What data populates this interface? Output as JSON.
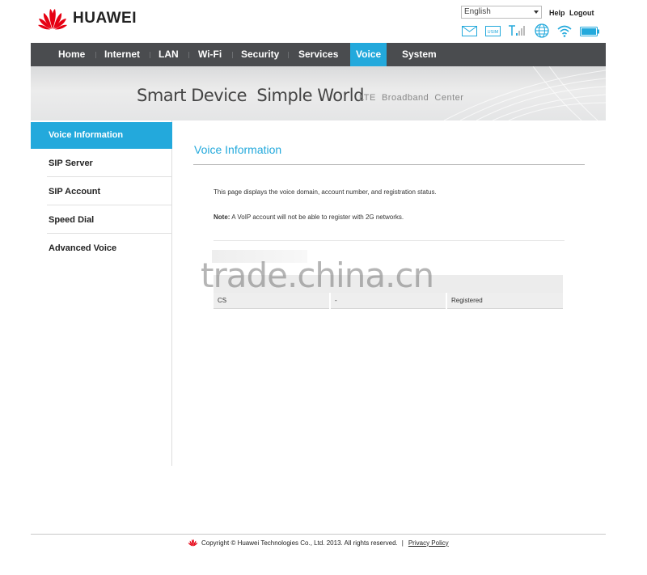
{
  "brand": {
    "name": "HUAWEI"
  },
  "header": {
    "language": "English",
    "help": "Help",
    "logout": "Logout",
    "status_icons": [
      "mail-icon",
      "usim-icon",
      "signal-icon",
      "globe-icon",
      "wifi-icon",
      "battery-icon"
    ],
    "usim_label": "USIM"
  },
  "nav": {
    "items": [
      "Home",
      "Internet",
      "LAN",
      "Wi-Fi",
      "Security",
      "Services",
      "Voice",
      "System"
    ],
    "active": "Voice"
  },
  "banner": {
    "main": "Smart Device  Simple World",
    "sub": "LTE  Broadband  Center"
  },
  "sidebar": {
    "items": [
      "Voice Information",
      "SIP Server",
      "SIP Account",
      "Speed Dial",
      "Advanced Voice"
    ],
    "active": "Voice Information"
  },
  "content": {
    "title": "Voice Information",
    "description": "This page displays the voice domain, account number, and registration status.",
    "note_label": "Note:",
    "note_text": " A VoIP account will not be able to register with 2G networks.",
    "table": {
      "rows": [
        {
          "domain": "CS",
          "account": "-",
          "status": "Registered"
        }
      ]
    }
  },
  "watermark": "trade.china.cn",
  "footer": {
    "copyright": "Copyright © Huawei Technologies Co., Ltd. 2013. All rights reserved.",
    "separator": "|",
    "privacy": "Privacy Policy"
  },
  "colors": {
    "accent": "#23a9dc",
    "nav_bg": "#4a4c4f",
    "brand_red": "#e60012"
  }
}
